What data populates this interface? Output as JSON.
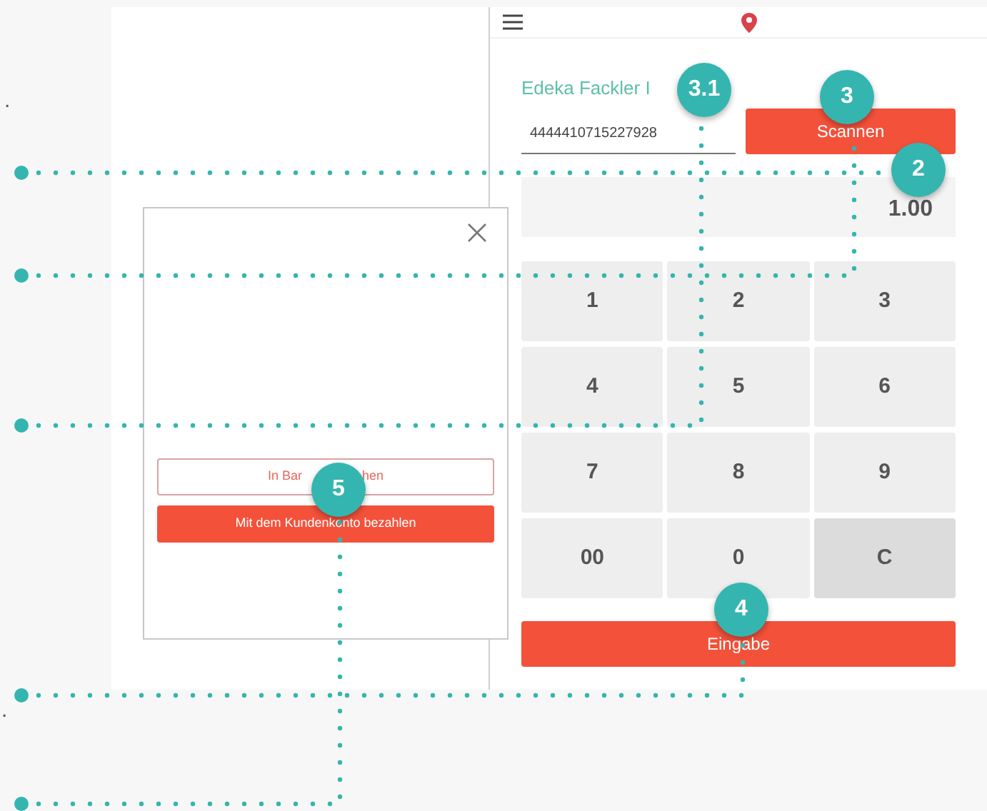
{
  "edge_texts": [
    ".",
    "."
  ],
  "app": {
    "store_name": "Edeka Fackler I",
    "card_field": {
      "value": "4444410715227928"
    },
    "scan_button": "Scannen",
    "amount": "1.00",
    "keys": [
      {
        "label": "1",
        "kind": "digit"
      },
      {
        "label": "2",
        "kind": "digit"
      },
      {
        "label": "3",
        "kind": "digit"
      },
      {
        "label": "4",
        "kind": "digit"
      },
      {
        "label": "5",
        "kind": "digit"
      },
      {
        "label": "6",
        "kind": "digit"
      },
      {
        "label": "7",
        "kind": "digit"
      },
      {
        "label": "8",
        "kind": "digit"
      },
      {
        "label": "9",
        "kind": "digit"
      },
      {
        "label": "00",
        "kind": "digit"
      },
      {
        "label": "0",
        "kind": "digit"
      },
      {
        "label": "C",
        "kind": "clear"
      }
    ],
    "enter_button": "Eingabe"
  },
  "dialog": {
    "cash_button_parts": [
      "In Bar",
      "hen"
    ],
    "account_button": "Mit dem Kundenkonto bezahlen"
  },
  "callouts": [
    {
      "label": "3.1"
    },
    {
      "label": "3"
    },
    {
      "label": "2"
    },
    {
      "label": "5"
    },
    {
      "label": "4"
    }
  ]
}
